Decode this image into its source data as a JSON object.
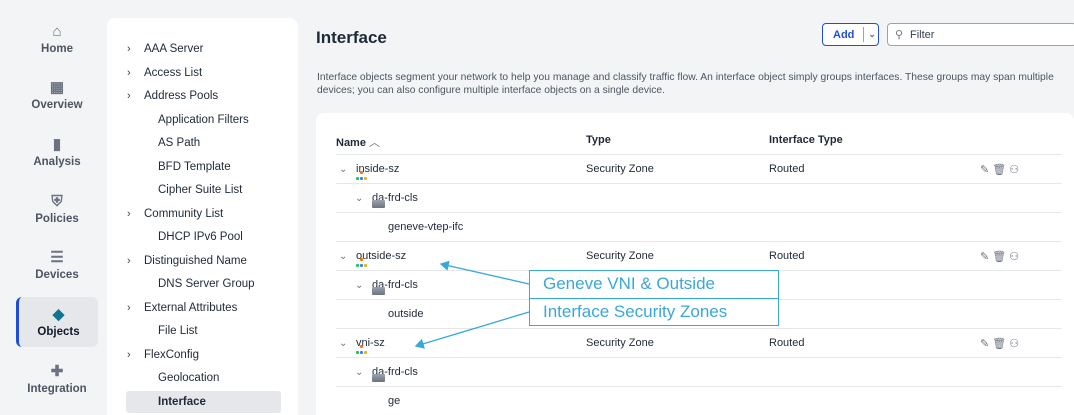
{
  "rail": [
    {
      "label": "Home",
      "icon": "home-icon",
      "glyph": "⌂"
    },
    {
      "label": "Overview",
      "icon": "overview-icon",
      "glyph": "▦"
    },
    {
      "label": "Analysis",
      "icon": "analysis-icon",
      "glyph": "▮"
    },
    {
      "label": "Policies",
      "icon": "policies-icon",
      "glyph": "⛨"
    },
    {
      "label": "Devices",
      "icon": "devices-icon",
      "glyph": "☰"
    },
    {
      "label": "Objects",
      "icon": "objects-icon",
      "glyph": "◆"
    },
    {
      "label": "Integration",
      "icon": "integration-icon",
      "glyph": "✚"
    }
  ],
  "sidebar": {
    "items": [
      {
        "label": "AAA Server",
        "expandable": true
      },
      {
        "label": "Access List",
        "expandable": true
      },
      {
        "label": "Address Pools",
        "expandable": true
      },
      {
        "label": "Application Filters",
        "expandable": false
      },
      {
        "label": "AS Path",
        "expandable": false
      },
      {
        "label": "BFD Template",
        "expandable": false
      },
      {
        "label": "Cipher Suite List",
        "expandable": false
      },
      {
        "label": "Community List",
        "expandable": true
      },
      {
        "label": "DHCP IPv6 Pool",
        "expandable": false
      },
      {
        "label": "Distinguished Name",
        "expandable": true
      },
      {
        "label": "DNS Server Group",
        "expandable": false
      },
      {
        "label": "External Attributes",
        "expandable": true
      },
      {
        "label": "File List",
        "expandable": false
      },
      {
        "label": "FlexConfig",
        "expandable": true
      },
      {
        "label": "Geolocation",
        "expandable": false
      },
      {
        "label": "Interface",
        "expandable": false,
        "selected": true
      }
    ]
  },
  "main": {
    "title": "Interface",
    "add_label": "Add",
    "filter_placeholder": "Filter",
    "description": "Interface objects segment your network to help you manage and classify traffic flow. An interface object simply groups interfaces. These groups may span multiple devices; you can also configure multiple interface objects on a single device."
  },
  "table": {
    "headers": {
      "name": "Name",
      "type": "Type",
      "interface_type": "Interface Type"
    },
    "rows": [
      {
        "level": 0,
        "name": "inside-sz",
        "type": "Security Zone",
        "interface_type": "Routed"
      },
      {
        "level": 1,
        "name": "da-frd-cls"
      },
      {
        "level": 2,
        "name": "geneve-vtep-ifc"
      },
      {
        "level": 0,
        "name": "outside-sz",
        "type": "Security Zone",
        "interface_type": "Routed"
      },
      {
        "level": 1,
        "name": "da-frd-cls"
      },
      {
        "level": 2,
        "name": "outside"
      },
      {
        "level": 0,
        "name": "vni-sz",
        "type": "Security Zone",
        "interface_type": "Routed"
      },
      {
        "level": 1,
        "name": "da-frd-cls"
      },
      {
        "level": 2,
        "name": "ge"
      }
    ]
  },
  "callout": {
    "line1": "Geneve VNI & Outside",
    "line2": "Interface Security Zones",
    "color": "#38a7dc"
  },
  "colors": {
    "accent": "#1d4ed8",
    "selected_bg": "#e5e7eb"
  }
}
